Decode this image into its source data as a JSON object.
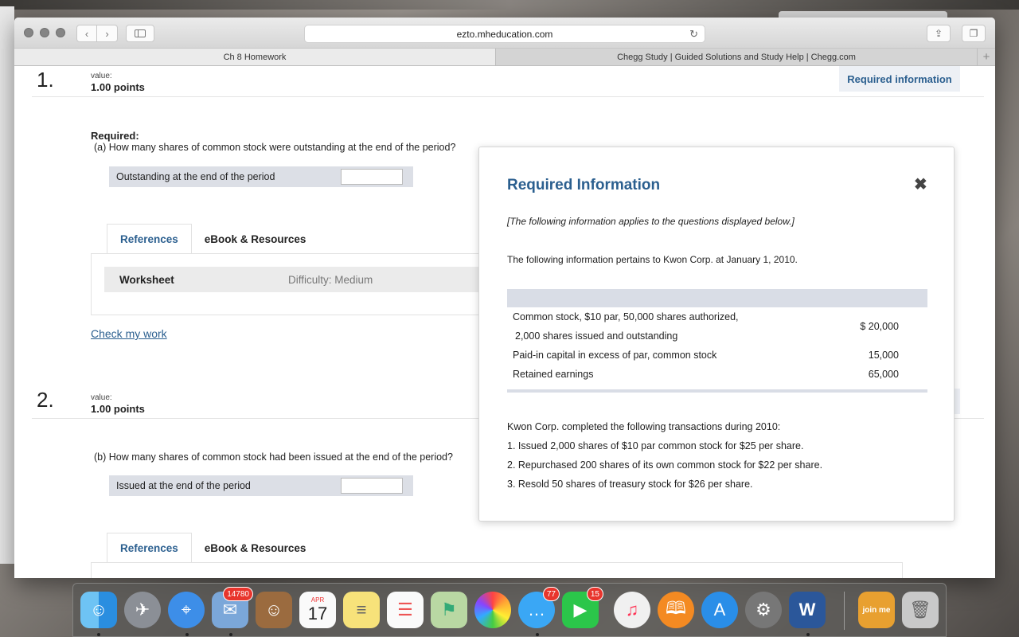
{
  "browser": {
    "url": "ezto.mheducation.com",
    "tabs": [
      {
        "label": "Ch 8 Homework"
      },
      {
        "label": "Chegg Study | Guided Solutions and Study Help | Chegg.com"
      }
    ]
  },
  "page": {
    "required_info_button": "Required information",
    "questions": [
      {
        "number": "1.",
        "value_label": "value:",
        "points": "1.00 points",
        "required_label": "Required:",
        "prompt": "(a) How many shares of common stock were outstanding at the end of the period?",
        "answer_label": "Outstanding at the end of the period"
      },
      {
        "number": "2.",
        "value_label": "value:",
        "points": "1.00 points",
        "prompt": "(b) How many shares of common stock had been issued at the end of the period?",
        "answer_label": "Issued at the end of the period"
      }
    ],
    "references_tab": "References",
    "ebook_tab": "eBook & Resources",
    "worksheet_label": "Worksheet",
    "difficulty_label": "Difficulty: Medium",
    "check_link": "Check my work"
  },
  "modal": {
    "title": "Required Information",
    "close_glyph": "✖",
    "italic_note": "[The following information applies to the questions displayed below.]",
    "intro": "The following information pertains to Kwon Corp. at January 1, 2010.",
    "table": [
      {
        "label_line1": "Common stock, $10 par, 50,000 shares authorized,",
        "label_line2": "2,000 shares issued and outstanding",
        "value": "$ 20,000"
      },
      {
        "label": "Paid-in capital in excess of par, common stock",
        "value": "15,000"
      },
      {
        "label": "Retained earnings",
        "value": "65,000"
      }
    ],
    "transactions_intro": "Kwon Corp. completed the following transactions during 2010:",
    "transactions": [
      "1.  Issued 2,000 shares of $10 par common stock for $25 per share.",
      "2.  Repurchased 200 shares of its own common stock for $22 per share.",
      "3.  Resold 50 shares of treasury stock for $26 per share."
    ]
  },
  "dock": {
    "mail_badge": "14780",
    "calendar_month": "APR",
    "calendar_day": "17",
    "messages_badge": "77",
    "facetime_badge": "15",
    "word_glyph": "W",
    "joinme_label": "join me",
    "icons": [
      "finder-icon",
      "launchpad-icon",
      "safari-icon",
      "mail-icon",
      "contacts-icon",
      "calendar-icon",
      "notes-icon",
      "reminders-icon",
      "maps-icon",
      "photos-icon",
      "messages-icon",
      "facetime-icon",
      "itunes-icon",
      "ibooks-icon",
      "appstore-icon",
      "system-preferences-icon",
      "word-icon",
      "joinme-icon",
      "trash-icon"
    ]
  }
}
